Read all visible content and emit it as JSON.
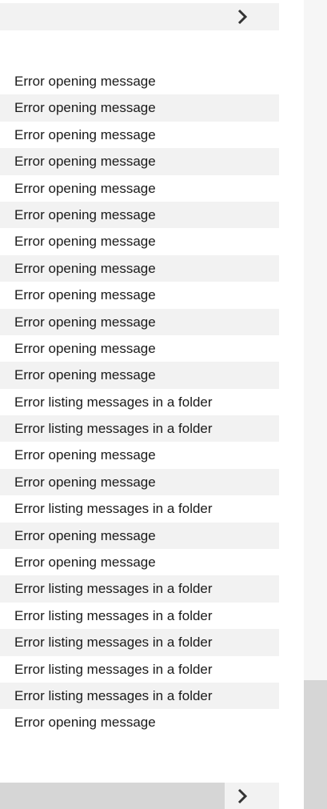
{
  "top_bar": {
    "arrow_icon": "chevron-right-icon"
  },
  "messages": [
    {
      "text": "Error opening message"
    },
    {
      "text": "Error opening message"
    },
    {
      "text": "Error opening message"
    },
    {
      "text": "Error opening message"
    },
    {
      "text": "Error opening message"
    },
    {
      "text": "Error opening message"
    },
    {
      "text": "Error opening message"
    },
    {
      "text": "Error opening message"
    },
    {
      "text": "Error opening message"
    },
    {
      "text": "Error opening message"
    },
    {
      "text": "Error opening message"
    },
    {
      "text": "Error opening message"
    },
    {
      "text": "Error listing messages in a folder"
    },
    {
      "text": "Error listing messages in a folder"
    },
    {
      "text": "Error opening message"
    },
    {
      "text": "Error opening message"
    },
    {
      "text": "Error listing messages in a folder"
    },
    {
      "text": "Error opening message"
    },
    {
      "text": "Error opening message"
    },
    {
      "text": "Error listing messages in a folder"
    },
    {
      "text": "Error listing messages in a folder"
    },
    {
      "text": "Error listing messages in a folder"
    },
    {
      "text": "Error listing messages in a folder"
    },
    {
      "text": "Error listing messages in a folder"
    },
    {
      "text": "Error opening message"
    }
  ],
  "scrollbars": {
    "horizontal_arrow_icon": "chevron-right-icon"
  },
  "colors": {
    "row_alt_background": "#f2f2f2",
    "scroll_thumb": "#d6d6d6",
    "text": "#1a1a1a"
  }
}
